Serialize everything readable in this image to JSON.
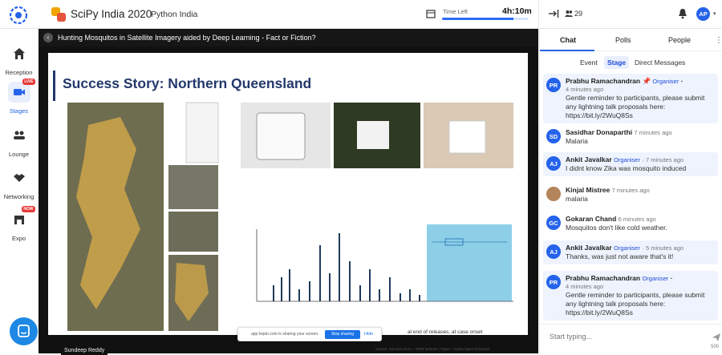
{
  "header": {
    "event_title": "SciPy India 2020",
    "organizer": "Python India",
    "timer_label": "Time Left",
    "timer_value": "4h:10m",
    "timer_progress": 0.82,
    "attendee_count": "29",
    "user_initials": "AP"
  },
  "sidebar": {
    "items": [
      {
        "label": "Reception",
        "icon": "home-icon"
      },
      {
        "label": "Stages",
        "icon": "video-camera-icon",
        "badge": "LIVE"
      },
      {
        "label": "Lounge",
        "icon": "lounge-icon"
      },
      {
        "label": "Networking",
        "icon": "handshake-icon"
      },
      {
        "label": "Expo",
        "icon": "expo-icon",
        "badge": "NOW"
      }
    ]
  },
  "stage": {
    "session_title": "Hunting Mosquitos in Satellite Imagery aided by Deep Learning - Fact or Fiction?",
    "slide_title": "Success Story: Northern Queensland",
    "speaker_name": "Sundeep Reddy",
    "share_text": "app.hopin.com is sharing your screen.",
    "stop_sharing": "Stop sharing",
    "hide": "Hide",
    "chart_caption": "al end of releases, at case onset",
    "source_text": "Source: Success story – WMP website | Paper – Gates Open Research"
  },
  "chat": {
    "tabs": [
      "Chat",
      "Polls",
      "People"
    ],
    "subtabs": [
      "Event",
      "Stage",
      "Direct Messages"
    ],
    "messages": [
      {
        "initials": "PR",
        "name": "Prabhu Ramachandran",
        "role": "Organiser",
        "time": "4 minutes ago",
        "text": "Gentle reminder to participants, please submit any lightning talk proposals here:",
        "link": "https://bit.ly/2WuQ8Ss",
        "pinned": true
      },
      {
        "initials": "SD",
        "name": "Sasidhar Donaparthi",
        "role": "",
        "time": "7 minutes ago",
        "text": "Malaria"
      },
      {
        "initials": "AJ",
        "name": "Ankit Javalkar",
        "role": "Organiser",
        "time": "7 minutes ago",
        "text": "I didnt know Zika was mosquito induced"
      },
      {
        "initials": "",
        "name": "Kinjal Mistree",
        "role": "",
        "time": "7 minutes ago",
        "text": "malaria"
      },
      {
        "initials": "GC",
        "name": "Gokaran Chand",
        "role": "",
        "time": "6 minutes ago",
        "text": "Mosquitos don't like cold weather."
      },
      {
        "initials": "AJ",
        "name": "Ankit Javalkar",
        "role": "Organiser",
        "time": "5 minutes ago",
        "text": "Thanks, was just not aware that's it!"
      },
      {
        "initials": "PR",
        "name": "Prabhu Ramachandran",
        "role": "Organiser",
        "time": "4 minutes ago",
        "text": "Gentle reminder to participants, please submit any lightning talk proposals here:",
        "link": "https://bit.ly/2WuQ8Ss"
      }
    ],
    "compose_placeholder": "Start typing...",
    "char_count": "500"
  },
  "colors": {
    "accent": "#2563eb",
    "live": "#e53935",
    "stage_bg": "#111111"
  }
}
